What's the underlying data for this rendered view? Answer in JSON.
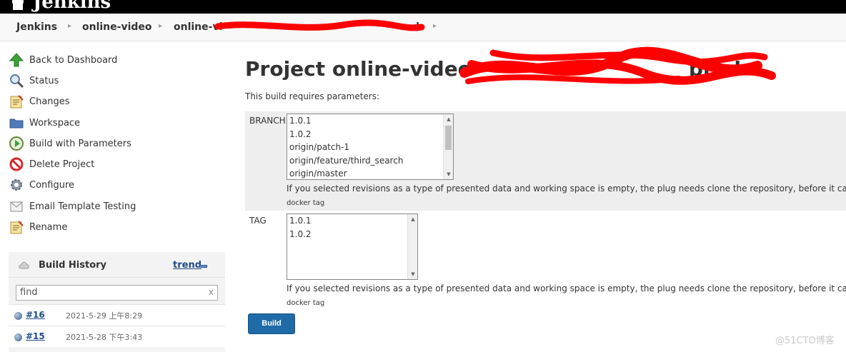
{
  "header": {
    "brand": "Jenkins"
  },
  "breadcrumb": {
    "items": [
      "Jenkins",
      "online-video",
      "online-vi",
      "d"
    ]
  },
  "tasks": [
    {
      "label": "Back to Dashboard",
      "icon": "up-arrow-icon"
    },
    {
      "label": "Status",
      "icon": "magnifier-icon"
    },
    {
      "label": "Changes",
      "icon": "notepad-icon"
    },
    {
      "label": "Workspace",
      "icon": "folder-icon"
    },
    {
      "label": "Build with Parameters",
      "icon": "clock-play-icon"
    },
    {
      "label": "Delete Project",
      "icon": "no-entry-icon"
    },
    {
      "label": "Configure",
      "icon": "gear-icon"
    },
    {
      "label": "Email Template Testing",
      "icon": "envelope-icon"
    },
    {
      "label": "Rename",
      "icon": "notepad-icon"
    }
  ],
  "build_history": {
    "title": "Build History",
    "trend": "trend",
    "search_value": "find",
    "builds": [
      {
        "number": "#16",
        "date": "2021-5-29 上午8:29"
      },
      {
        "number": "#15",
        "date": "2021-5-28 下午3:43"
      }
    ]
  },
  "main": {
    "title_start": "Project online-video",
    "title_end": "prod",
    "subtitle": "This build requires parameters:",
    "branch": {
      "label": "BRANCH",
      "options": [
        "1.0.1",
        "1.0.2",
        "origin/patch-1",
        "origin/feature/third_search",
        "origin/master"
      ],
      "description": "If you selected revisions as a type of presented data and working space is empty, the plug needs clone the repository, before it can display",
      "note": "docker tag"
    },
    "tag": {
      "label": "TAG",
      "options": [
        "1.0.1",
        "1.0.2"
      ],
      "description": "If you selected revisions as a type of presented data and working space is empty, the plug needs clone the repository, before it can display",
      "note": "docker tag"
    },
    "build_button": "Build"
  },
  "watermark": "@51CTO博客",
  "colors": {
    "header_bg": "#000000",
    "button_bg": "#1f6ba8",
    "link": "#204a87",
    "redaction": "#ff0000"
  }
}
